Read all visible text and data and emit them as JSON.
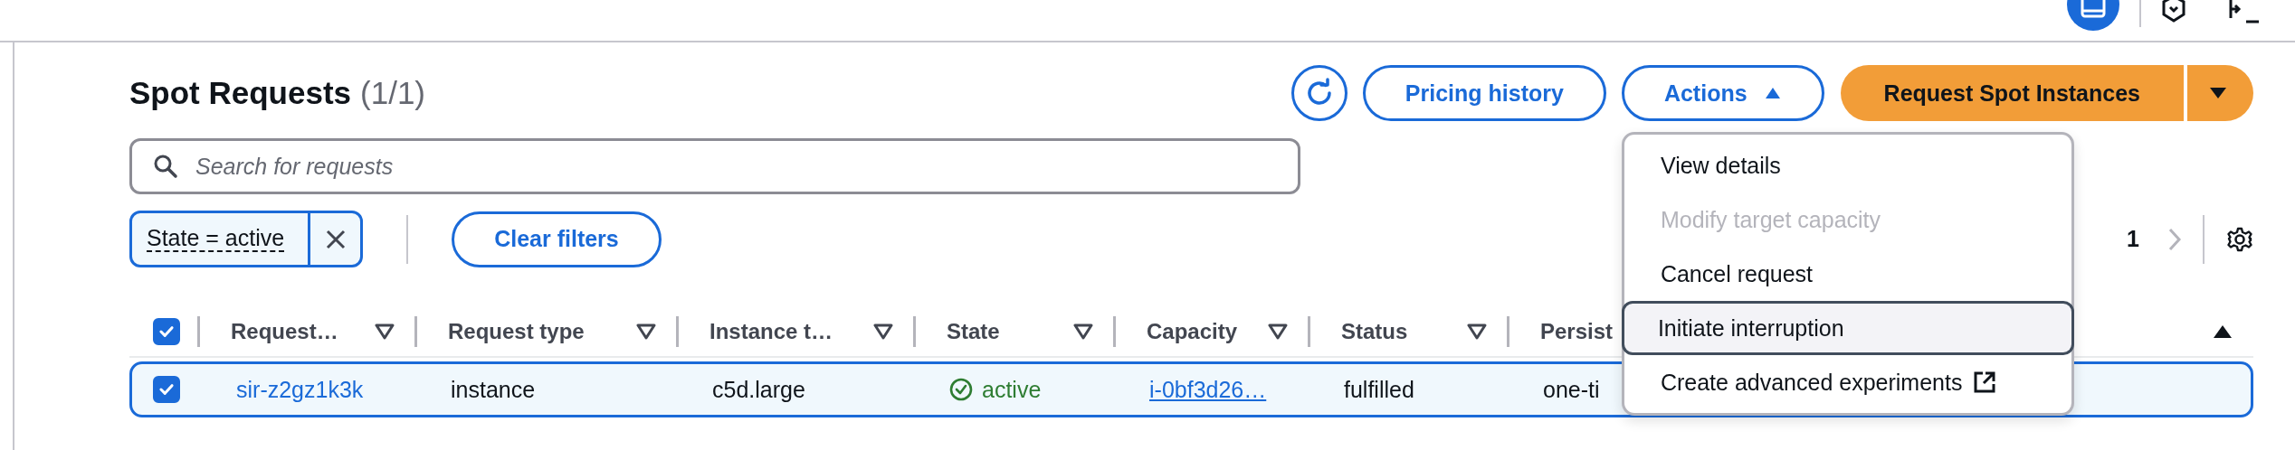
{
  "title": "Spot Requests",
  "count": "(1/1)",
  "toolbar": {
    "pricing_history": "Pricing history",
    "actions": {
      "label": "Actions",
      "expanded": true
    },
    "primary": "Request Spot Instances"
  },
  "search": {
    "placeholder": "Search for requests"
  },
  "filter_token": "State = active",
  "clear_filters": "Clear filters",
  "pagination": {
    "page": "1"
  },
  "table": {
    "all_selected": true,
    "columns": [
      {
        "label": "Request…"
      },
      {
        "label": "Request type"
      },
      {
        "label": "Instance t…"
      },
      {
        "label": "State"
      },
      {
        "label": "Capacity"
      },
      {
        "label": "Status"
      },
      {
        "label": "Persist"
      }
    ],
    "rows": [
      {
        "selected": true,
        "cells": [
          {
            "kind": "link",
            "text": "sir-z2gz1k3k"
          },
          {
            "kind": "text",
            "text": "instance"
          },
          {
            "kind": "text",
            "text": "c5d.large"
          },
          {
            "kind": "status",
            "text": "active"
          },
          {
            "kind": "underlined-link",
            "text": "i-0bf3d26…"
          },
          {
            "kind": "text",
            "text": "fulfilled"
          },
          {
            "kind": "text",
            "text": "one-ti"
          }
        ]
      }
    ]
  },
  "menu": {
    "items": [
      {
        "label": "View details",
        "disabled": false,
        "focused": false,
        "external": false
      },
      {
        "label": "Modify target capacity",
        "disabled": true,
        "focused": false,
        "external": false
      },
      {
        "label": "Cancel request",
        "disabled": false,
        "focused": false,
        "external": false
      },
      {
        "label": "Initiate interruption",
        "disabled": false,
        "focused": true,
        "external": false
      },
      {
        "label": "Create advanced experiments",
        "disabled": false,
        "focused": false,
        "external": true
      }
    ]
  }
}
